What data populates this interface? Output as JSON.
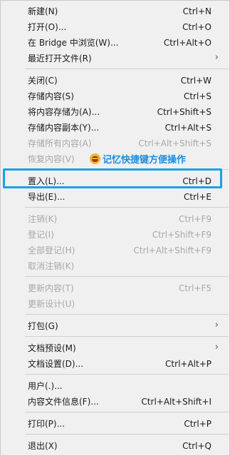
{
  "menu": {
    "groups": [
      [
        {
          "label": "新建(N)",
          "shortcut": "Ctrl+N"
        },
        {
          "label": "打开(O)...",
          "shortcut": "Ctrl+O"
        },
        {
          "label": "在 Bridge 中浏览(W)...",
          "shortcut": "Ctrl+Alt+O"
        },
        {
          "label": "最近打开文件(R)",
          "shortcut": "",
          "submenu": true
        }
      ],
      [
        {
          "label": "关闭(C)",
          "shortcut": "Ctrl+W"
        },
        {
          "label": "存储内容(S)",
          "shortcut": "Ctrl+S"
        },
        {
          "label": "将内容存储为(A)...",
          "shortcut": "Ctrl+Shift+S"
        },
        {
          "label": "存储内容副本(Y)...",
          "shortcut": "Ctrl+Alt+S"
        },
        {
          "label": "存储所有内容(A)",
          "shortcut": "Ctrl+Alt+Shift+S",
          "disabled": true
        },
        {
          "label": "恢复内容(V)",
          "shortcut": "",
          "disabled": true
        }
      ],
      [
        {
          "label": "置入(L)...",
          "shortcut": "Ctrl+D",
          "highlighted": true
        },
        {
          "label": "导出(E)...",
          "shortcut": "Ctrl+E"
        }
      ],
      [
        {
          "label": "注销(K)",
          "shortcut": "Ctrl+F9",
          "disabled": true
        },
        {
          "label": "登记(I)",
          "shortcut": "Ctrl+Shift+F9",
          "disabled": true
        },
        {
          "label": "全部登记(H)",
          "shortcut": "Ctrl+Alt+Shift+F9",
          "disabled": true
        },
        {
          "label": "取消注销(K)",
          "shortcut": "",
          "disabled": true
        }
      ],
      [
        {
          "label": "更新内容(T)",
          "shortcut": "Ctrl+F5",
          "disabled": true
        },
        {
          "label": "更新设计(U)",
          "shortcut": "",
          "disabled": true
        }
      ],
      [
        {
          "label": "打包(G)",
          "shortcut": "",
          "submenu": true
        }
      ],
      [
        {
          "label": "文档预设(M)",
          "shortcut": "",
          "submenu": true
        },
        {
          "label": "文档设置(D)...",
          "shortcut": "Ctrl+Alt+P"
        }
      ],
      [
        {
          "label": "用户(.)...",
          "shortcut": ""
        },
        {
          "label": "内容文件信息(F)...",
          "shortcut": "Ctrl+Alt+Shift+I"
        }
      ],
      [
        {
          "label": "打印(P)...",
          "shortcut": "Ctrl+P"
        }
      ],
      [
        {
          "label": "退出(X)",
          "shortcut": "Ctrl+Q"
        }
      ]
    ]
  },
  "annotation": {
    "text": "记忆快捷键方便操作",
    "icon": "grinning-face-emoji"
  },
  "colors": {
    "highlight_border": "#1aa0e8",
    "annotation_text": "#1a8fe0",
    "disabled_text": "#a8a8a8"
  },
  "submenu_arrow": "›"
}
